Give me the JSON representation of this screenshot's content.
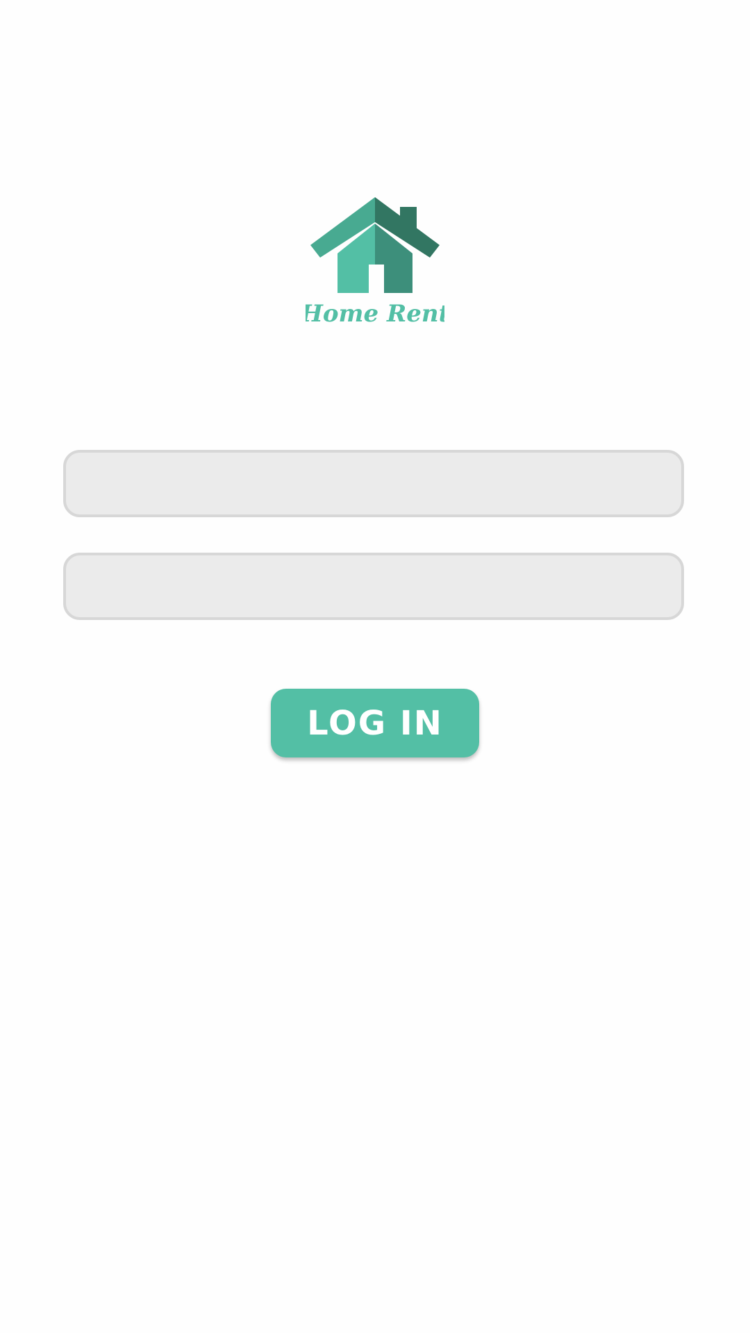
{
  "logo": {
    "icon": "house-icon",
    "text": "Home Rent",
    "colors": {
      "wall_light": "#53bfa5",
      "wall_dark": "#3d8f7b",
      "roof_light": "#48aa91",
      "roof_dark": "#327662"
    }
  },
  "form": {
    "username_value": "",
    "username_placeholder": "",
    "password_value": "",
    "password_placeholder": ""
  },
  "login_button": {
    "label": "LOG IN",
    "color": "#53bfa5"
  }
}
